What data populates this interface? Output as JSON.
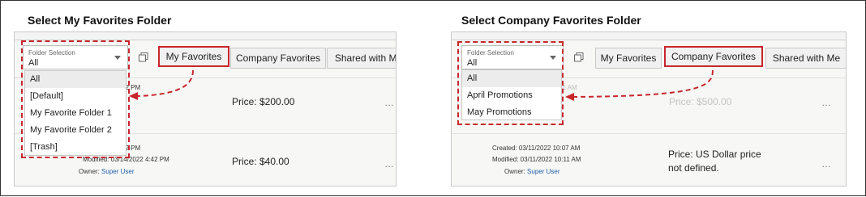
{
  "left": {
    "title": "Select My Favorites Folder",
    "folder_label": "Folder Selection",
    "folder_value": "All",
    "tabs": [
      "My Favorites",
      "Company Favorites",
      "Shared with Me"
    ],
    "dropdown": [
      "All",
      "[Default]",
      "My Favorite Folder 1",
      "My Favorite Folder 2",
      "[Trash]"
    ],
    "card1": {
      "time_fragment": "32 PM",
      "price": "Price: $200.00"
    },
    "card2": {
      "created_fragment": "32 PM",
      "modified_fragment": "Modified: 03/14/2022 4:42 PM",
      "owner_label": "Owner:",
      "owner_name": "Super User",
      "price": "Price: $40.00"
    },
    "more": "…"
  },
  "right": {
    "title": "Select Company Favorites Folder",
    "folder_label": "Folder Selection",
    "folder_value": "All",
    "tabs": [
      "My Favorites",
      "Company Favorites",
      "Shared with Me"
    ],
    "dropdown": [
      "All",
      "April Promotions",
      "May Promotions"
    ],
    "card1": {
      "time_fragment": "21 AM",
      "price": "Price: $500.00"
    },
    "card2": {
      "created": "Created: 03/11/2022 10:07 AM",
      "modified": "Modified: 03/11/2022 10:11 AM",
      "owner_label": "Owner:",
      "owner_name": "Super User",
      "price_line1": "Price: US Dollar price",
      "price_line2": "not defined."
    },
    "more": "…"
  },
  "colors": {
    "highlight": "#c8262c",
    "link": "#1f5fa8"
  }
}
